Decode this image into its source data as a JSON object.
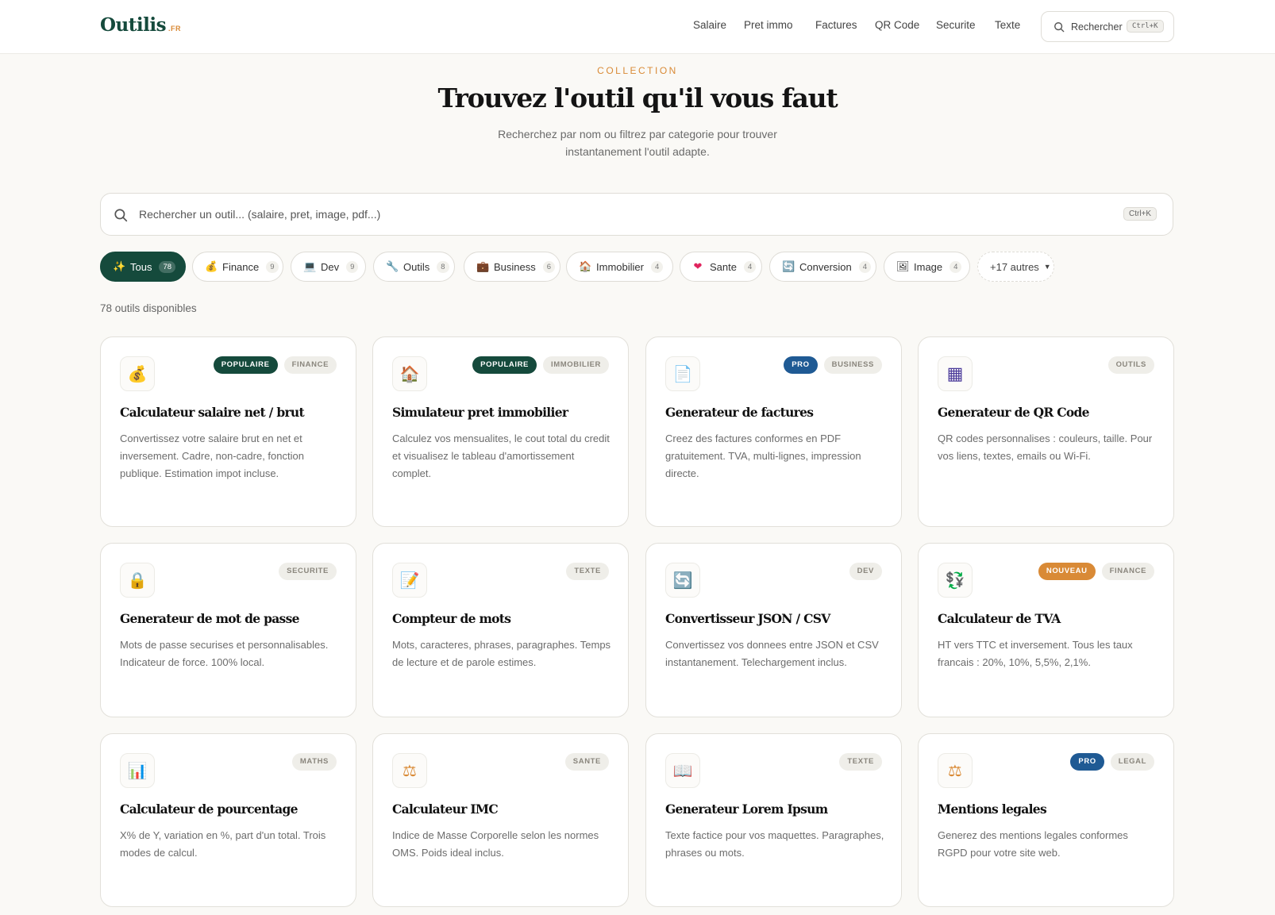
{
  "header": {
    "logo": "Outilis",
    "logo_tld": ".FR",
    "nav": [
      "Salaire",
      "Pret immo",
      "Factures",
      "QR Code",
      "Securite",
      "Texte"
    ],
    "search_label": "Rechercher",
    "search_shortcut": "Ctrl+K"
  },
  "hero": {
    "eyebrow": "COLLECTION",
    "title": "Trouvez l'outil qu'il vous faut",
    "subtitle": "Recherchez par nom ou filtrez par categorie pour trouver instantanement l'outil adapte."
  },
  "search": {
    "placeholder": "Rechercher un outil... (salaire, pret, image, pdf...)",
    "value": "",
    "shortcut": "Ctrl+K"
  },
  "filters": [
    {
      "icon": "✨",
      "label": "Tous",
      "count": "78",
      "active": true
    },
    {
      "icon": "💰",
      "label": "Finance",
      "count": "9"
    },
    {
      "icon": "💻",
      "label": "Dev",
      "count": "9"
    },
    {
      "icon": "🔧",
      "label": "Outils",
      "count": "8"
    },
    {
      "icon": "💼",
      "label": "Business",
      "count": "6"
    },
    {
      "icon": "🏠",
      "label": "Immobilier",
      "count": "4"
    },
    {
      "icon": "❤",
      "label": "Sante",
      "count": "4"
    },
    {
      "icon": "🔄",
      "label": "Conversion",
      "count": "4"
    },
    {
      "icon": "🖼",
      "label": "Image",
      "count": "4"
    }
  ],
  "more_filters": "+17 autres",
  "tools_count": "78 outils disponibles",
  "colors": {
    "brand": "#154a3c",
    "accent": "#d98a36",
    "pro": "#1f5a94"
  },
  "cards": [
    {
      "icon": "💰",
      "icon_name": "money-bag-icon",
      "badges": [
        {
          "text": "POPULAIRE",
          "type": "pop"
        },
        {
          "text": "FINANCE",
          "type": "cat"
        }
      ],
      "title": "Calculateur salaire net / brut",
      "desc": "Convertissez votre salaire brut en net et inversement. Cadre, non-cadre, fonction publique. Estimation impot incluse."
    },
    {
      "icon": "🏠",
      "icon_name": "house-icon",
      "badges": [
        {
          "text": "POPULAIRE",
          "type": "pop"
        },
        {
          "text": "IMMOBILIER",
          "type": "cat"
        }
      ],
      "title": "Simulateur pret immobilier",
      "desc": "Calculez vos mensualites, le cout total du credit et visualisez le tableau d'amortissement complet."
    },
    {
      "icon": "📄",
      "icon_name": "document-icon",
      "badges": [
        {
          "text": "PRO",
          "type": "pro"
        },
        {
          "text": "BUSINESS",
          "type": "cat"
        }
      ],
      "title": "Generateur de factures",
      "desc": "Creez des factures conformes en PDF gratuitement. TVA, multi-lignes, impression directe."
    },
    {
      "icon": "▦",
      "icon_name": "qr-code-icon",
      "badges": [
        {
          "text": "OUTILS",
          "type": "cat"
        }
      ],
      "title": "Generateur de QR Code",
      "desc": "QR codes personnalises : couleurs, taille. Pour vos liens, textes, emails ou Wi-Fi."
    },
    {
      "icon": "🔒",
      "icon_name": "lock-icon",
      "badges": [
        {
          "text": "SECURITE",
          "type": "cat"
        }
      ],
      "title": "Generateur de mot de passe",
      "desc": "Mots de passe securises et personnalisables. Indicateur de force. 100% local."
    },
    {
      "icon": "📝",
      "icon_name": "memo-icon",
      "badges": [
        {
          "text": "TEXTE",
          "type": "cat"
        }
      ],
      "title": "Compteur de mots",
      "desc": "Mots, caracteres, phrases, paragraphes. Temps de lecture et de parole estimes."
    },
    {
      "icon": "🔄",
      "icon_name": "convert-arrows-icon",
      "badges": [
        {
          "text": "DEV",
          "type": "cat"
        }
      ],
      "title": "Convertisseur JSON / CSV",
      "desc": "Convertissez vos donnees entre JSON et CSV instantanement. Telechargement inclus."
    },
    {
      "icon": "💱",
      "icon_name": "currency-exchange-icon",
      "badges": [
        {
          "text": "NOUVEAU",
          "type": "new"
        },
        {
          "text": "FINANCE",
          "type": "cat"
        }
      ],
      "title": "Calculateur de TVA",
      "desc": "HT vers TTC et inversement. Tous les taux francais : 20%, 10%, 5,5%, 2,1%."
    },
    {
      "icon": "📊",
      "icon_name": "bar-chart-icon",
      "badges": [
        {
          "text": "MATHS",
          "type": "cat"
        }
      ],
      "title": "Calculateur de pourcentage",
      "desc": "X% de Y, variation en %, part d'un total. Trois modes de calcul."
    },
    {
      "icon": "⚖",
      "icon_name": "scales-icon",
      "badges": [
        {
          "text": "SANTE",
          "type": "cat"
        }
      ],
      "title": "Calculateur IMC",
      "desc": "Indice de Masse Corporelle selon les normes OMS. Poids ideal inclus."
    },
    {
      "icon": "📖",
      "icon_name": "open-book-icon",
      "badges": [
        {
          "text": "TEXTE",
          "type": "cat"
        }
      ],
      "title": "Generateur Lorem Ipsum",
      "desc": "Texte factice pour vos maquettes. Paragraphes, phrases ou mots."
    },
    {
      "icon": "⚖",
      "icon_name": "scales-icon",
      "badges": [
        {
          "text": "PRO",
          "type": "pro"
        },
        {
          "text": "LEGAL",
          "type": "cat"
        }
      ],
      "title": "Mentions legales",
      "desc": "Generez des mentions legales conformes RGPD pour votre site web."
    }
  ]
}
